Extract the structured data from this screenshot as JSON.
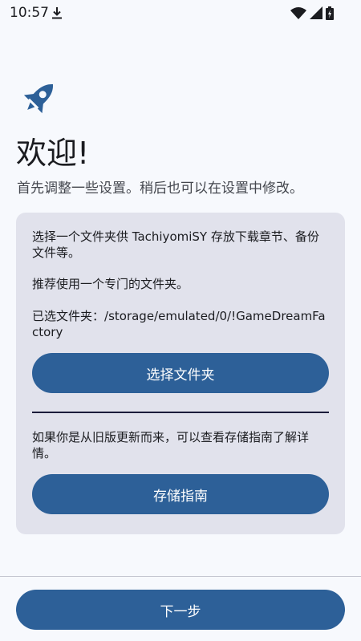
{
  "status_bar": {
    "time": "10:57",
    "icons": [
      "download-icon",
      "wifi-icon",
      "cellular-signal-icon",
      "battery-icon"
    ]
  },
  "welcome": {
    "icon": "rocket-icon",
    "title": "欢迎!",
    "subtitle": "首先调整一些设置。稍后也可以在设置中修改。"
  },
  "storage_card": {
    "description": "选择一个文件夹供 TachiyomiSY 存放下载章节、备份文件等。",
    "recommendation": "推荐使用一个专门的文件夹。",
    "selected_label": "已选文件夹：",
    "selected_path": "/storage/emulated/0/!GameDreamFactory",
    "choose_button": "选择文件夹",
    "upgrade_hint": "如果你是从旧版更新而来，可以查看存储指南了解详情。",
    "guide_button": "存储指南"
  },
  "footer": {
    "next_button": "下一步"
  },
  "colors": {
    "accent": "#2d6098",
    "background": "#f7f9fd",
    "card": "#e1e2ec"
  }
}
